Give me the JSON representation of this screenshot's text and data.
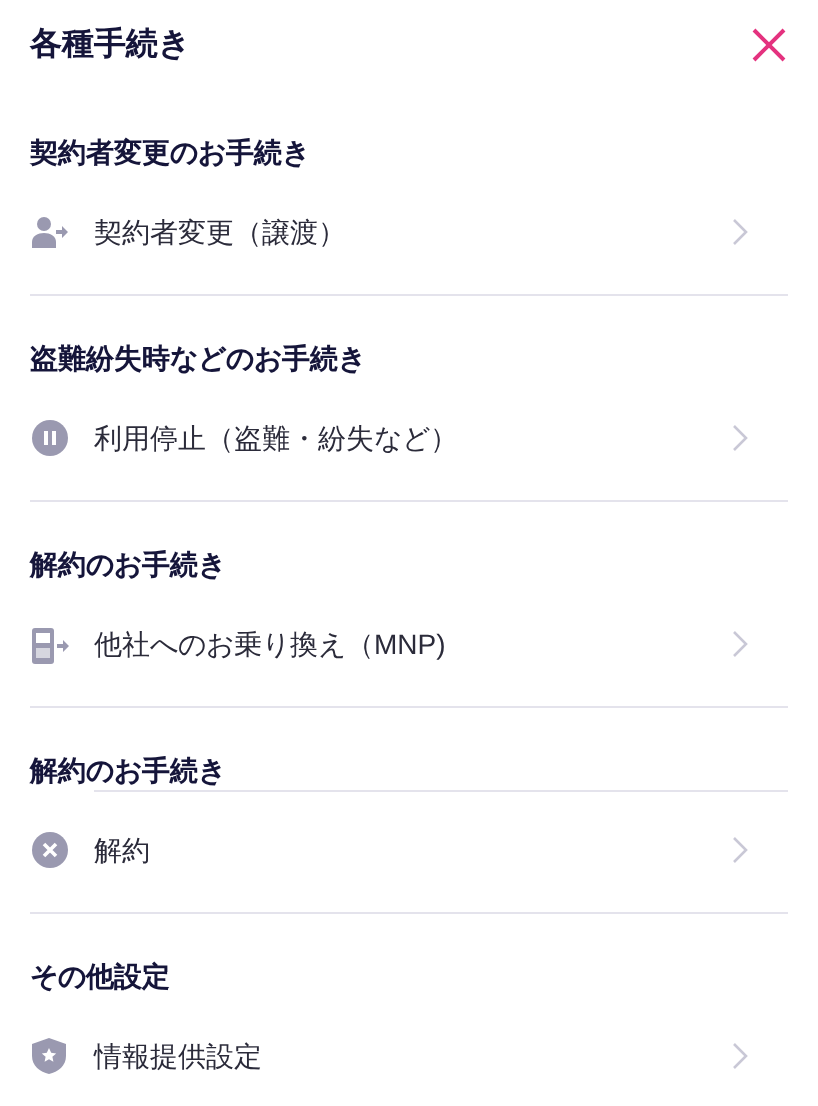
{
  "title": "各種手続き",
  "sections": [
    {
      "header": "契約者変更のお手続き",
      "item": {
        "label": "契約者変更（譲渡）",
        "kind": "person-transfer",
        "separator_above": false
      }
    },
    {
      "header": "盗難紛失時などのお手続き",
      "item": {
        "label": "利用停止（盗難・紛失など）",
        "kind": "pause",
        "separator_above": false
      }
    },
    {
      "header": "解約のお手続き",
      "item": {
        "label": "他社へのお乗り換え（MNP)",
        "kind": "phone-transfer",
        "separator_above": false
      }
    },
    {
      "header": "解約のお手続き",
      "item": {
        "label": "解約",
        "kind": "cancel",
        "separator_above": true
      }
    },
    {
      "header": "その他設定",
      "item": {
        "label": "情報提供設定",
        "kind": "shield-star",
        "separator_above": false
      }
    }
  ]
}
